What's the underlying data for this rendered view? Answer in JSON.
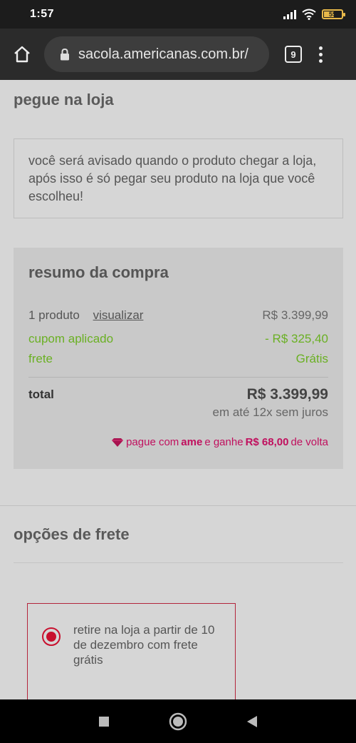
{
  "status_bar": {
    "time": "1:57",
    "battery_level": "55"
  },
  "browser": {
    "url": "sacola.americanas.com.br/",
    "tab_count": "9"
  },
  "pickup": {
    "title": "pegue na loja",
    "notice": "você será avisado quando o produto chegar a loja, após isso é só pegar seu produto na loja que você escolheu!"
  },
  "summary": {
    "title": "resumo da compra",
    "products_label": "1 produto",
    "view_link": "visualizar",
    "products_value": "R$ 3.399,99",
    "coupon_label": "cupom aplicado",
    "coupon_value": "- R$ 325,40",
    "shipping_label": "frete",
    "shipping_value": "Grátis",
    "total_label": "total",
    "total_value": "R$ 3.399,99",
    "installments": "em até 12x sem juros",
    "ame_prefix": "pague com",
    "ame_brand": "ame",
    "ame_middle": "e ganhe",
    "ame_amount": "R$ 68,00",
    "ame_suffix": "de volta"
  },
  "shipping_options": {
    "title": "opções de frete",
    "options": [
      {
        "label": "retire na loja a partir de 10 de dezembro com frete grátis",
        "selected": true
      }
    ]
  },
  "colors": {
    "accent_red": "#c8102e",
    "green": "#6ab023",
    "ame_pink": "#c0105e"
  }
}
